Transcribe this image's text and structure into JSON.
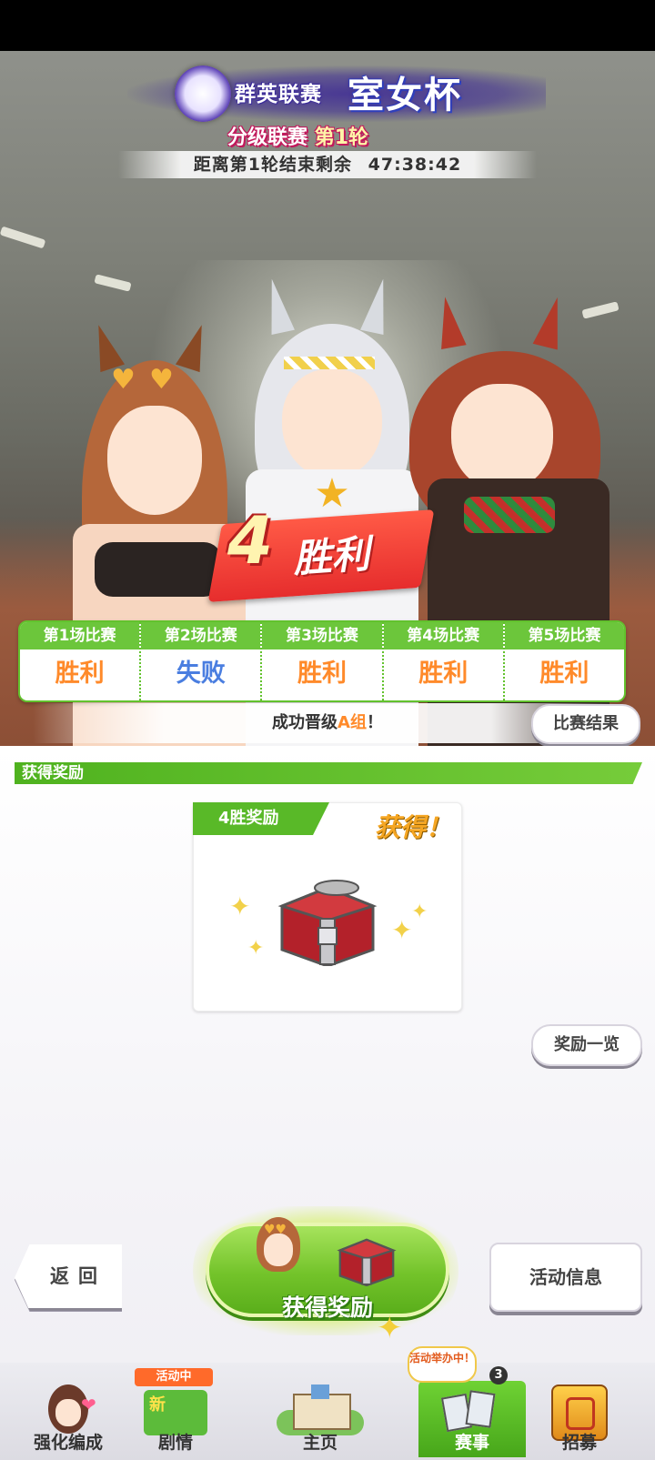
{
  "header": {
    "title_left": "群英联赛",
    "title_right": "室女杯",
    "subtitle_prefix": "分级联赛",
    "subtitle_round": "第1轮",
    "countdown_label": "距离第1轮结束剩余",
    "countdown_time": "47:38:42"
  },
  "result": {
    "wins_number": "4",
    "wins_label": "胜利",
    "matches": [
      {
        "label": "第1场比赛",
        "result": "胜利"
      },
      {
        "label": "第2场比赛",
        "result": "失败"
      },
      {
        "label": "第3场比赛",
        "result": "胜利"
      },
      {
        "label": "第4场比赛",
        "result": "胜利"
      },
      {
        "label": "第5场比赛",
        "result": "胜利"
      }
    ],
    "promotion_prefix": "成功晋级",
    "promotion_group": "A组",
    "promotion_suffix": "！",
    "result_button": "比赛结果"
  },
  "rewards": {
    "section_title": "获得奖励",
    "card_tag": "4胜奖励",
    "obtained_label": "获得！",
    "list_button": "奖励一览"
  },
  "actions": {
    "back_label": "返回",
    "claim_label": "获得奖励",
    "info_label": "活动信息"
  },
  "nav": {
    "items": [
      {
        "label": "强化编成",
        "icon": "character-icon"
      },
      {
        "label": "剧情",
        "icon": "story-book-icon",
        "badge": "活动中",
        "new_label": "新"
      },
      {
        "label": "主页",
        "icon": "home-building-icon"
      },
      {
        "label": "赛事",
        "icon": "race-icon",
        "badge": "活动举办中！",
        "count": "3"
      },
      {
        "label": "招募",
        "icon": "gacha-icon"
      }
    ],
    "active": "赛事"
  },
  "colors": {
    "win": "#ff8a2a",
    "lose": "#4a7ee0",
    "accent_green": "#6cc63b"
  }
}
